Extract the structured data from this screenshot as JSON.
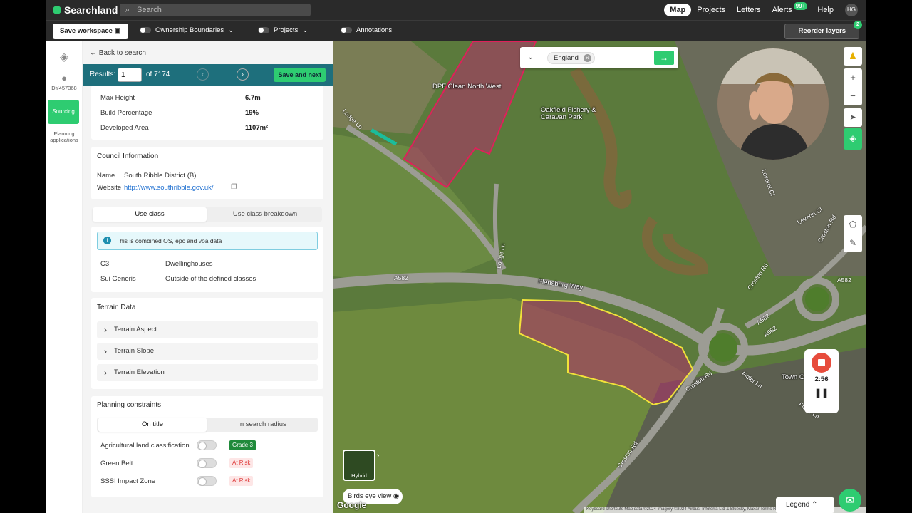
{
  "app": {
    "name": "Searchland",
    "search_placeholder": "Search"
  },
  "nav": {
    "items": [
      "Map",
      "Projects",
      "Letters",
      "Alerts",
      "Help"
    ],
    "alerts_badge": "99+",
    "avatar": "HG"
  },
  "toolbar": {
    "save_workspace": "Save workspace",
    "ownership": "Ownership Boundaries",
    "projects": "Projects",
    "annotations": "Annotations",
    "reorder": "Reorder layers",
    "reorder_count": "2"
  },
  "rail": {
    "user_id": "DY457368",
    "sourcing": "Sourcing",
    "planning": "Planning applications"
  },
  "panel": {
    "back": "Back to search",
    "results": {
      "label": "Results:",
      "value": "1",
      "of": "of 7174",
      "save_next": "Save and next"
    },
    "building": [
      {
        "k": "Max Height",
        "v": "6.7m"
      },
      {
        "k": "Build Percentage",
        "v": "19%"
      },
      {
        "k": "Developed Area",
        "v": "1107m²"
      }
    ],
    "council": {
      "title": "Council Information",
      "name_label": "Name",
      "name": "South Ribble District (B)",
      "website_label": "Website",
      "website": "http://www.southribble.gov.uk/"
    },
    "use_class": {
      "tabs": [
        "Use class",
        "Use class breakdown"
      ],
      "info": "This is combined OS, epc and voa data",
      "rows": [
        {
          "code": "C3",
          "desc": "Dwellinghouses"
        },
        {
          "code": "Sui Generis",
          "desc": "Outside of the defined classes"
        }
      ]
    },
    "terrain": {
      "title": "Terrain Data",
      "items": [
        "Terrain Aspect",
        "Terrain Slope",
        "Terrain Elevation"
      ]
    },
    "planning": {
      "title": "Planning constraints",
      "tabs": [
        "On title",
        "In search radius"
      ],
      "rows": [
        {
          "label": "Agricultural land classification",
          "tag": "Grade 3"
        },
        {
          "label": "Green Belt",
          "tag": "At Risk"
        },
        {
          "label": "SSSI Impact Zone",
          "tag": "At Risk"
        }
      ]
    }
  },
  "map": {
    "search_chip": "England",
    "labels": {
      "dpf": "DPF Clean North West",
      "oakfield": "Oakfield Fishery & Caravan Park",
      "flensburg": "Flensburg Way",
      "town": "Town Ce"
    },
    "roads": [
      "Lodge Ln",
      "Lodge Ln",
      "A582",
      "A582",
      "A582",
      "A582",
      "Croston Rd",
      "Croston Rd",
      "Croston Rd",
      "Fidler Ln",
      "Fidler Ln",
      "Leveret Cl",
      "Leveret Cl",
      "Croston Rd"
    ],
    "timer": "2:56",
    "hybrid": "Hybrid",
    "birds_eye": "Birds eye view",
    "google": "Google",
    "legend": "Legend",
    "attribution": "Keyboard shortcuts   Map data ©2024 Imagery ©2024 Airbus, Infoterra Ltd & Bluesky, Maxar   Terms   Report a map error",
    "colors": {
      "parcel_fill": "#b0306a",
      "parcel_stroke_yellow": "#f2e23a",
      "parcel_stroke_pink": "#e0205a",
      "accent": "#2ecc71"
    }
  }
}
